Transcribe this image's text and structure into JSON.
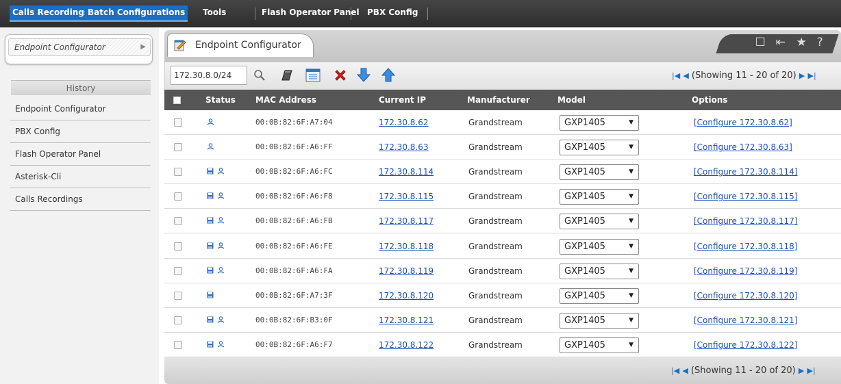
{
  "topbar": {
    "items": [
      {
        "label": "Calls Recordings",
        "active": true
      },
      {
        "label": "Batch Configurations",
        "active": true
      },
      {
        "label": "Tools",
        "active": false
      },
      {
        "label": "Flash Operator Panel",
        "active": false
      },
      {
        "label": "PBX Config",
        "active": false
      }
    ]
  },
  "sidebar": {
    "current": "Endpoint Configurator",
    "history_label": "History",
    "history": [
      "Endpoint Configurator",
      "PBX Config",
      "Flash Operator Panel",
      "Asterisk-Cli",
      "Calls Recordings"
    ]
  },
  "main": {
    "tab_title": "Endpoint Configurator",
    "tools": [
      "edit-icon",
      "collapse-icon",
      "star-icon",
      "help-icon"
    ],
    "filter": {
      "network": "172.30.8.0/24"
    },
    "toolbar_icons": [
      "search-icon",
      "scan-icon",
      "list-icon",
      "delete-icon",
      "download-icon",
      "upload-icon"
    ],
    "pager_text": "(Showing 11 - 20 of 20)",
    "columns": [
      "Status",
      "MAC Address",
      "Current IP",
      "Manufacturer",
      "Model",
      "Options"
    ],
    "rows": [
      {
        "mac": "00:0B:82:6F:A7:04",
        "ip": "172.30.8.62",
        "manufacturer": "Grandstream",
        "model": "GXP1405",
        "option": "[Configure 172.30.8.62]",
        "status": [
          "user"
        ]
      },
      {
        "mac": "00:0B:82:6F:A6:FF",
        "ip": "172.30.8.63",
        "manufacturer": "Grandstream",
        "model": "GXP1405",
        "option": "[Configure 172.30.8.63]",
        "status": [
          "user"
        ]
      },
      {
        "mac": "00:0B:82:6F:A6:FC",
        "ip": "172.30.8.114",
        "manufacturer": "Grandstream",
        "model": "GXP1405",
        "option": "[Configure 172.30.8.114]",
        "status": [
          "save",
          "user"
        ]
      },
      {
        "mac": "00:0B:82:6F:A6:F8",
        "ip": "172.30.8.115",
        "manufacturer": "Grandstream",
        "model": "GXP1405",
        "option": "[Configure 172.30.8.115]",
        "status": [
          "save",
          "user"
        ]
      },
      {
        "mac": "00:0B:82:6F:A6:FB",
        "ip": "172.30.8.117",
        "manufacturer": "Grandstream",
        "model": "GXP1405",
        "option": "[Configure 172.30.8.117]",
        "status": [
          "save",
          "user"
        ]
      },
      {
        "mac": "00:0B:82:6F:A6:FE",
        "ip": "172.30.8.118",
        "manufacturer": "Grandstream",
        "model": "GXP1405",
        "option": "[Configure 172.30.8.118]",
        "status": [
          "save",
          "user"
        ]
      },
      {
        "mac": "00:0B:82:6F:A6:FA",
        "ip": "172.30.8.119",
        "manufacturer": "Grandstream",
        "model": "GXP1405",
        "option": "[Configure 172.30.8.119]",
        "status": [
          "save",
          "user"
        ]
      },
      {
        "mac": "00:0B:82:6F:A7:3F",
        "ip": "172.30.8.120",
        "manufacturer": "Grandstream",
        "model": "GXP1405",
        "option": "[Configure 172.30.8.120]",
        "status": [
          "save"
        ]
      },
      {
        "mac": "00:0B:82:6F:B3:0F",
        "ip": "172.30.8.121",
        "manufacturer": "Grandstream",
        "model": "GXP1405",
        "option": "[Configure 172.30.8.121]",
        "status": [
          "save",
          "user"
        ]
      },
      {
        "mac": "00:0B:82:6F:A6:F7",
        "ip": "172.30.8.122",
        "manufacturer": "Grandstream",
        "model": "GXP1405",
        "option": "[Configure 172.30.8.122]",
        "status": [
          "save",
          "user"
        ]
      }
    ]
  },
  "colors": {
    "accent": "#1b6ec2",
    "topbar": "#3a3a3a",
    "header": "#565656",
    "link": "#1b4fb3",
    "delete": "#d42020"
  }
}
